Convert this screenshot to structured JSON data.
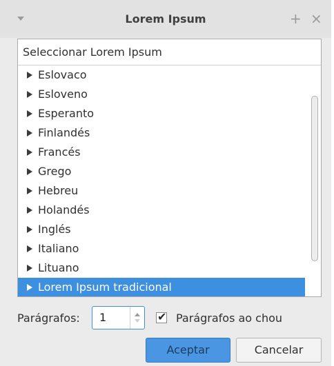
{
  "window": {
    "title": "Lorem Ipsum",
    "menu_icon": "menu-triangle-icon",
    "pin_glyph": "+",
    "close_glyph": "×"
  },
  "list": {
    "header": "Seleccionar Lorem Ipsum",
    "items": [
      {
        "label": "Eslovaco",
        "selected": false
      },
      {
        "label": "Esloveno",
        "selected": false
      },
      {
        "label": "Esperanto",
        "selected": false
      },
      {
        "label": "Finlandés",
        "selected": false
      },
      {
        "label": "Francés",
        "selected": false
      },
      {
        "label": "Grego",
        "selected": false
      },
      {
        "label": "Hebreu",
        "selected": false
      },
      {
        "label": "Holandés",
        "selected": false
      },
      {
        "label": "Inglés",
        "selected": false
      },
      {
        "label": "Italiano",
        "selected": false
      },
      {
        "label": "Lituano",
        "selected": false
      },
      {
        "label": "Lorem Ipsum tradicional",
        "selected": true
      }
    ]
  },
  "options": {
    "paragraphs_label": "Parágrafos:",
    "paragraphs_value": "1",
    "checkbox_label": "Parágrafos ao chou",
    "checkbox_checked": true,
    "checkmark_glyph": "✔"
  },
  "buttons": {
    "ok": "Aceptar",
    "cancel": "Cancelar"
  },
  "colors": {
    "selection": "#3d8fe0",
    "ok_button": "#4a96e3"
  }
}
